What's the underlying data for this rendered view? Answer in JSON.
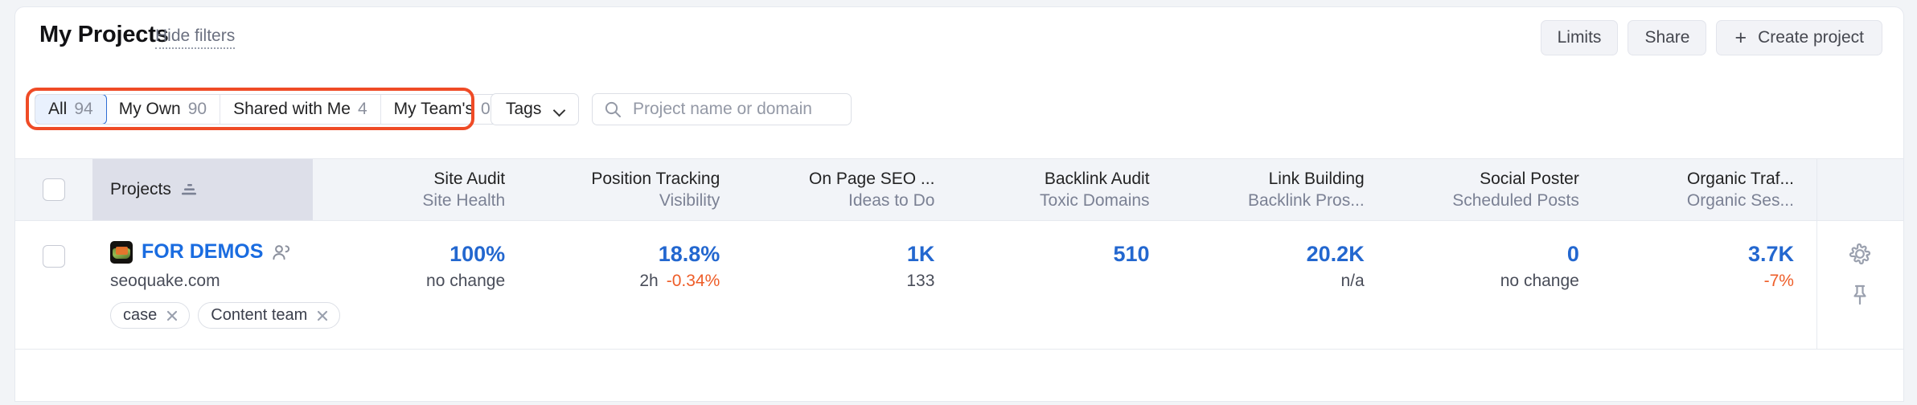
{
  "header": {
    "title": "My Projects",
    "hide_filters_label": "Hide filters",
    "buttons": {
      "limits": "Limits",
      "share": "Share",
      "create_project": "Create project",
      "create_project_plus": "+"
    }
  },
  "filters": {
    "tabs": [
      {
        "label": "All",
        "count": "94",
        "active": true
      },
      {
        "label": "My Own",
        "count": "90",
        "active": false
      },
      {
        "label": "Shared with Me",
        "count": "4",
        "active": false
      },
      {
        "label": "My Team's",
        "count": "0",
        "active": false
      }
    ],
    "tags_select_label": "Tags",
    "search_placeholder": "Project name or domain",
    "search_value": "",
    "highlight_color": "#ef4b26"
  },
  "table": {
    "checkbox_all_checked": false,
    "projects_column_header": "Projects",
    "columns": [
      {
        "title": "Site Audit",
        "sub": "Site Health"
      },
      {
        "title": "Position Tracking",
        "sub": "Visibility"
      },
      {
        "title": "On Page SEO ...",
        "sub": "Ideas to Do"
      },
      {
        "title": "Backlink Audit",
        "sub": "Toxic Domains"
      },
      {
        "title": "Link Building",
        "sub": "Backlink Pros..."
      },
      {
        "title": "Social Poster",
        "sub": "Scheduled Posts"
      },
      {
        "title": "Organic Traf...",
        "sub": "Organic Ses..."
      }
    ],
    "rows": [
      {
        "checked": false,
        "name": "FOR DEMOS",
        "domain": "seoquake.com",
        "shared": true,
        "tags": [
          {
            "label": "case"
          },
          {
            "label": "Content team"
          }
        ],
        "metrics": [
          {
            "main": "100%",
            "sub": "no change",
            "sub_delta": "",
            "delta_negative": false
          },
          {
            "main": "18.8%",
            "sub": "2h",
            "sub_delta": "-0.34%",
            "delta_negative": true
          },
          {
            "main": "1K",
            "sub": "133",
            "sub_delta": "",
            "delta_negative": false
          },
          {
            "main": "510",
            "sub": "",
            "sub_delta": "",
            "delta_negative": false
          },
          {
            "main": "20.2K",
            "sub": "n/a",
            "sub_delta": "",
            "delta_negative": false
          },
          {
            "main": "0",
            "sub": "no change",
            "sub_delta": "",
            "delta_negative": false
          },
          {
            "main": "3.7K",
            "sub": "",
            "sub_delta": "-7%",
            "delta_negative": true
          }
        ]
      }
    ]
  },
  "colors": {
    "link_blue": "#1a6ce0",
    "metric_blue": "#2367cf",
    "negative_orange": "#ee5d28",
    "highlight_red": "#ef4b26",
    "muted_text": "#7b8194"
  }
}
